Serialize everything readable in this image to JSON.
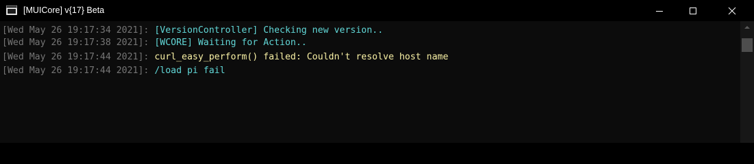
{
  "window": {
    "title": "[MUICore] v{17} Beta",
    "icons": {
      "app": "console-app-icon",
      "minimize": "minimize-icon",
      "maximize": "maximize-icon",
      "close": "close-icon",
      "scroll_up": "chevron-up-icon"
    }
  },
  "colors": {
    "background": "#0c0c0c",
    "timestamp": "#767676",
    "info": "#61d6d6",
    "error": "#f9f1a5"
  },
  "console": {
    "lines": [
      {
        "timestamp": "[Wed May 26 19:17:34 2021]: ",
        "message": "[VersionController] Checking new version..",
        "level": "info"
      },
      {
        "timestamp": "[Wed May 26 19:17:38 2021]: ",
        "message": "[WCORE] Waiting for Action..",
        "level": "info"
      },
      {
        "timestamp": "[Wed May 26 19:17:44 2021]: ",
        "message": "curl_easy_perform() failed: Couldn't resolve host name",
        "level": "error"
      },
      {
        "timestamp": "[Wed May 26 19:17:44 2021]: ",
        "message": "/load pi fail",
        "level": "info"
      }
    ]
  }
}
